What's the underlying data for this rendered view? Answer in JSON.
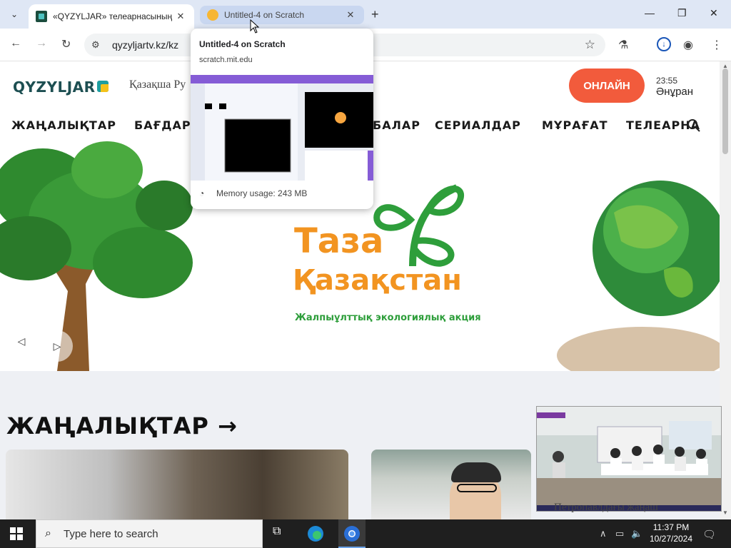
{
  "browser": {
    "tabs": [
      {
        "title": "«QYZYLJAR» телеарнасының р",
        "active": true
      },
      {
        "title": "Untitled-4 on Scratch",
        "active": false
      }
    ],
    "new_tab": "+",
    "url": "qyzyljartv.kz/kz"
  },
  "hover_card": {
    "title": "Untitled-4 on Scratch",
    "url": "scratch.mit.edu",
    "memory": "Memory usage: 243 MB"
  },
  "site": {
    "logo": "QYZYLJAR",
    "language": "Қазақша",
    "language_partial": "Ру",
    "online_button": "ОНЛАЙН",
    "time": "23:55",
    "program": "Әнұран",
    "menu": [
      "ЖАҢАЛЫҚТАР",
      "БАҒДАР",
      "БАЛАР",
      "СЕРИАЛДАР",
      "МҰРАҒАТ",
      "ТЕЛЕАРНА"
    ],
    "hero": {
      "line1": "Таза",
      "line2": "Қазақстан",
      "subtitle": "Жалпыұлттық экологиялық акция"
    },
    "news_heading": "ЖАҢАЛЫҚТАР →",
    "news_caption_partial": "Петропавлдағы жаңаш"
  },
  "taskbar": {
    "search_placeholder": "Type here to search",
    "time": "11:37 PM",
    "date": "10/27/2024"
  },
  "colors": {
    "accent_online": "#f25b3c",
    "logo_dark": "#1d4f52",
    "hero_orange": "#f29421",
    "hero_green": "#2e9e3b"
  }
}
